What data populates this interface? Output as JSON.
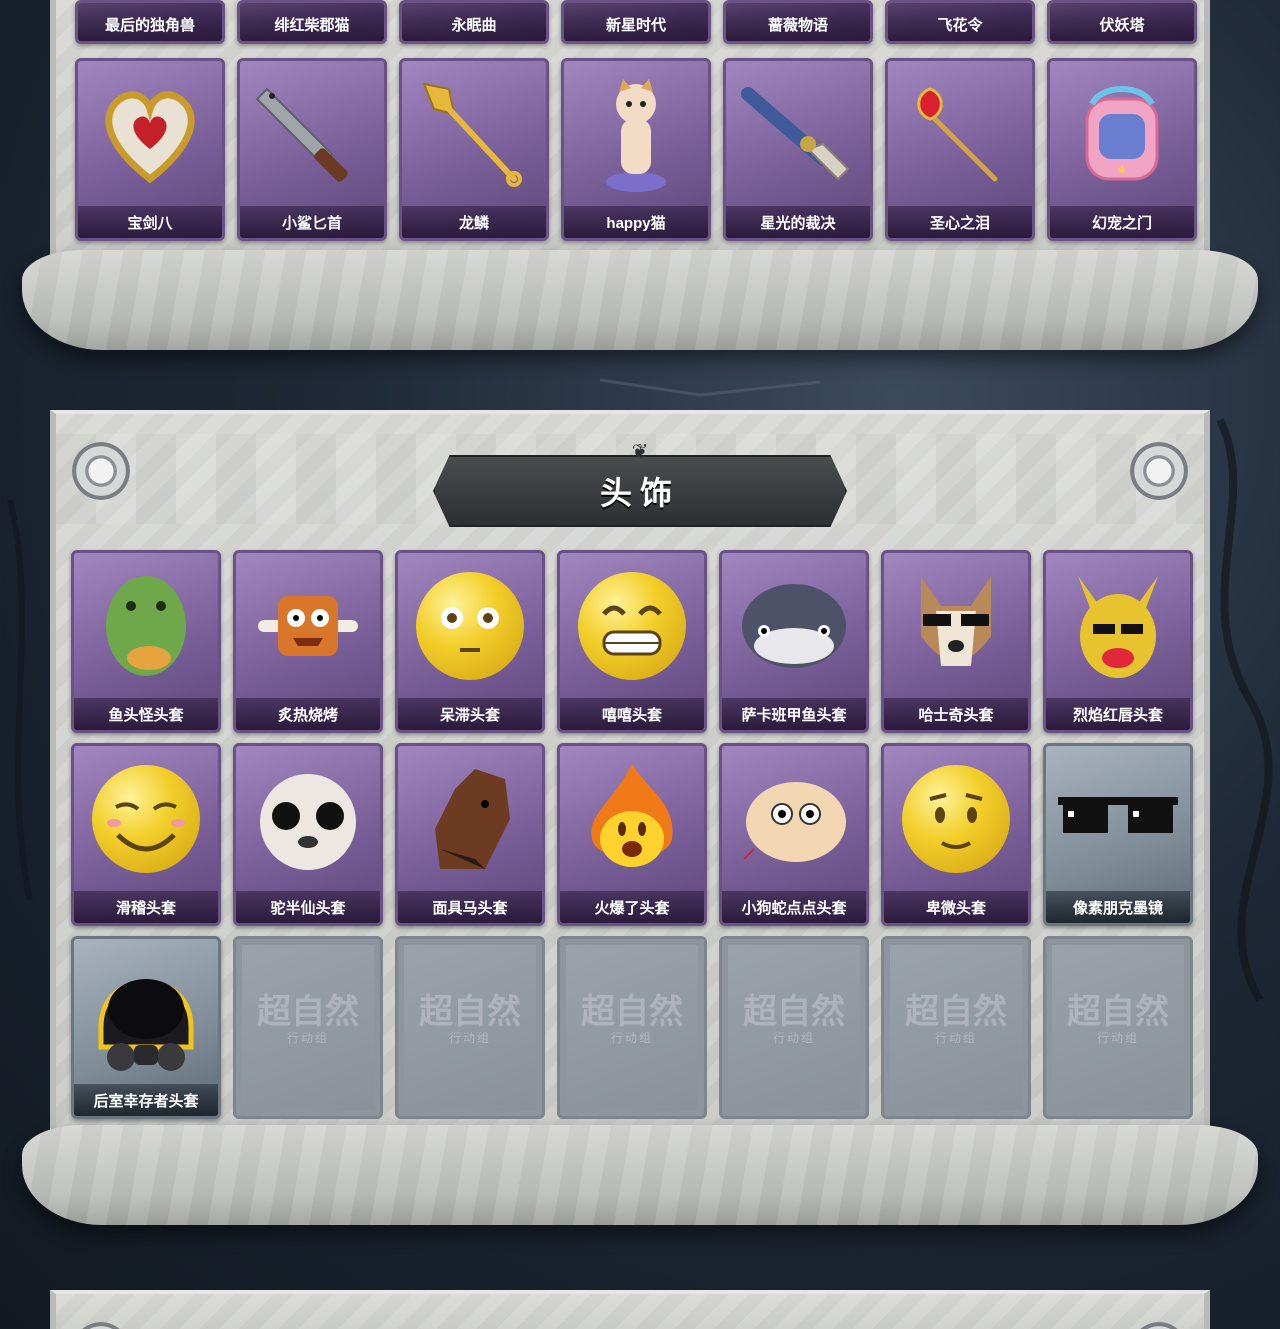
{
  "sections": {
    "top": {
      "row_a": [
        {
          "label": "最后的独角兽",
          "icon": "unicorn-item-icon"
        },
        {
          "label": "绯红柴郡猫",
          "icon": "cheshire-cat-item-icon"
        },
        {
          "label": "永眠曲",
          "icon": "lullaby-item-icon"
        },
        {
          "label": "新星时代",
          "icon": "nova-era-item-icon"
        },
        {
          "label": "蔷薇物语",
          "icon": "rose-story-item-icon"
        },
        {
          "label": "飞花令",
          "icon": "flying-flowers-item-icon"
        },
        {
          "label": "伏妖塔",
          "icon": "demon-tower-item-icon"
        }
      ],
      "row_b": [
        {
          "label": "宝剑八",
          "icon": "heart-shield-icon"
        },
        {
          "label": "小鲨匕首",
          "icon": "shark-dagger-icon"
        },
        {
          "label": "龙鳞",
          "icon": "golden-shovel-icon"
        },
        {
          "label": "happy猫",
          "icon": "cat-figure-icon"
        },
        {
          "label": "星光的裁决",
          "icon": "starlight-pistol-icon"
        },
        {
          "label": "圣心之泪",
          "icon": "ruby-scepter-icon"
        },
        {
          "label": "幻宠之门",
          "icon": "pet-device-icon"
        }
      ]
    },
    "headwear": {
      "title": "头饰",
      "row_c": [
        {
          "label": "鱼头怪头套",
          "icon": "fish-head-icon",
          "tier": "purple"
        },
        {
          "label": "炙热烧烤",
          "icon": "bbq-meat-icon",
          "tier": "purple"
        },
        {
          "label": "呆滞头套",
          "icon": "blank-face-icon",
          "tier": "purple"
        },
        {
          "label": "嘻嘻头套",
          "icon": "grin-face-icon",
          "tier": "purple"
        },
        {
          "label": "萨卡班甲鱼头套",
          "icon": "sacabambaspis-icon",
          "tier": "purple"
        },
        {
          "label": "哈士奇头套",
          "icon": "husky-sunglasses-icon",
          "tier": "purple"
        },
        {
          "label": "烈焰红唇头套",
          "icon": "yellow-mouse-icon",
          "tier": "purple"
        }
      ],
      "row_d": [
        {
          "label": "滑稽头套",
          "icon": "funny-face-icon",
          "tier": "purple"
        },
        {
          "label": "驼半仙头套",
          "icon": "alpaca-sunglasses-icon",
          "tier": "purple"
        },
        {
          "label": "面具马头套",
          "icon": "horse-mask-icon",
          "tier": "purple"
        },
        {
          "label": "火爆了头套",
          "icon": "fire-spirit-icon",
          "tier": "purple"
        },
        {
          "label": "小狗蛇点点头套",
          "icon": "snake-dog-icon",
          "tier": "purple"
        },
        {
          "label": "卑微头套",
          "icon": "humble-face-icon",
          "tier": "purple"
        },
        {
          "label": "像素朋克墨镜",
          "icon": "pixel-sunglasses-icon",
          "tier": "silver"
        }
      ],
      "row_e": [
        {
          "label": "后室幸存者头套",
          "icon": "gas-mask-helmet-icon",
          "tier": "silver"
        },
        {
          "placeholder_logo": "超自然",
          "placeholder_sub": "行动组",
          "icon": "empty-slot-icon"
        },
        {
          "placeholder_logo": "超自然",
          "placeholder_sub": "行动组",
          "icon": "empty-slot-icon"
        },
        {
          "placeholder_logo": "超自然",
          "placeholder_sub": "行动组",
          "icon": "empty-slot-icon"
        },
        {
          "placeholder_logo": "超自然",
          "placeholder_sub": "行动组",
          "icon": "empty-slot-icon"
        },
        {
          "placeholder_logo": "超自然",
          "placeholder_sub": "行动组",
          "icon": "empty-slot-icon"
        },
        {
          "placeholder_logo": "超自然",
          "placeholder_sub": "行动组",
          "icon": "empty-slot-icon"
        }
      ]
    }
  },
  "colors": {
    "purple_card": "#7a5f99",
    "silver_card": "#7f8b97",
    "banner": "#2d2f32",
    "parchment": "#d0d2ce"
  }
}
